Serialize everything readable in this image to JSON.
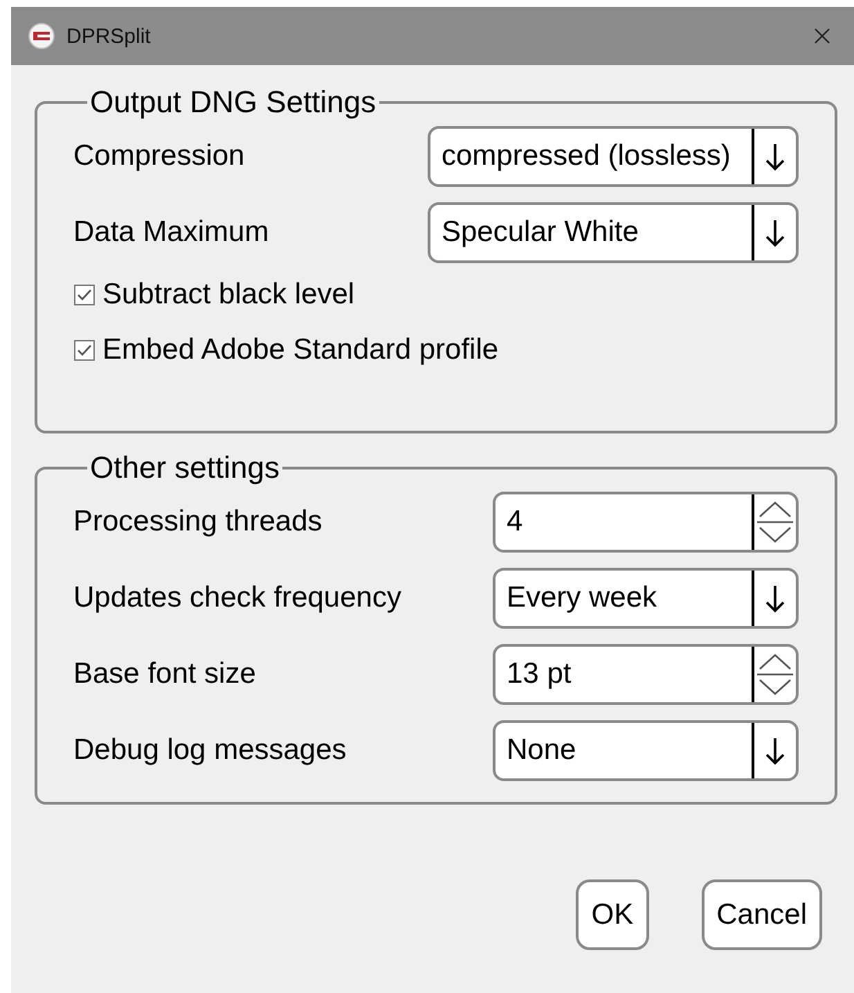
{
  "window": {
    "title": "DPRSplit"
  },
  "groups": [
    {
      "title": "Output DNG Settings",
      "fields": [
        {
          "kind": "dropdown",
          "label": "Compression",
          "value": "compressed (lossless)"
        },
        {
          "kind": "dropdown",
          "label": "Data Maximum",
          "value": "Specular White"
        }
      ],
      "checkboxes": [
        {
          "label": "Subtract black level",
          "checked": true
        },
        {
          "label": "Embed Adobe Standard profile",
          "checked": true
        }
      ]
    },
    {
      "title": "Other settings",
      "fields": [
        {
          "kind": "spinbox",
          "label": "Processing threads",
          "value": "4"
        },
        {
          "kind": "dropdown",
          "label": "Updates check frequency",
          "value": "Every week"
        },
        {
          "kind": "spinbox",
          "label": "Base font size",
          "value": "13 pt"
        },
        {
          "kind": "dropdown",
          "label": "Debug log messages",
          "value": "None"
        }
      ]
    }
  ],
  "buttons": [
    "OK",
    "Cancel"
  ]
}
